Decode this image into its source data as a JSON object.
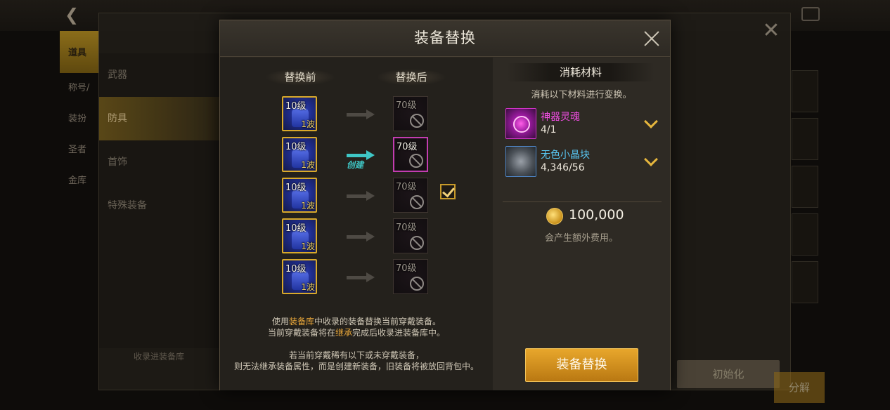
{
  "background": {
    "left_tab": "道具",
    "side_items": [
      "称号/",
      "装扮",
      "圣者",
      "金库"
    ],
    "menu_items": [
      "武器",
      "防具",
      "首饰",
      "特殊装备"
    ],
    "menu_selected": "防具",
    "collect_label": "收录进装备库",
    "init_button": "初始化",
    "split_button": "分解"
  },
  "modal": {
    "title": "装备替换",
    "before_header": "替换前",
    "after_header": "替换后",
    "create_label": "创建",
    "before_items": [
      {
        "level": "10级",
        "sub": "1波"
      },
      {
        "level": "10级",
        "sub": "1波"
      },
      {
        "level": "10级",
        "sub": "1波"
      },
      {
        "level": "10级",
        "sub": "1波"
      },
      {
        "level": "10级",
        "sub": "1波"
      }
    ],
    "after_items": [
      {
        "level": "70级"
      },
      {
        "level": "70级"
      },
      {
        "level": "70级"
      },
      {
        "level": "70级"
      },
      {
        "level": "70级"
      }
    ],
    "selected_row": 1,
    "note1": {
      "a": "使用",
      "b": "装备库",
      "c": "中收录的装备替换当前穿戴装备。"
    },
    "note2": {
      "a": "当前穿戴装备将在",
      "b": "继承",
      "c": "完成后收录进装备库中。"
    },
    "note3": "若当前穿戴稀有以下或未穿戴装备，",
    "note4": "则无法继承装备属性，而是创建新装备，旧装备将被放回背包中。",
    "materials": {
      "header": "消耗材料",
      "description": "消耗以下材料进行变换。",
      "items": [
        {
          "name": "神器灵魂",
          "count": "4/1",
          "color": "#f14ee3",
          "icon": "artifact-soul-icon"
        },
        {
          "name": "无色小晶块",
          "count": "4,346/56",
          "color": "#58c6f2",
          "icon": "colorless-crystal-icon"
        }
      ],
      "gold": "100,000",
      "extra_cost": "会产生额外费用。"
    },
    "confirm_button": "装备替换"
  }
}
